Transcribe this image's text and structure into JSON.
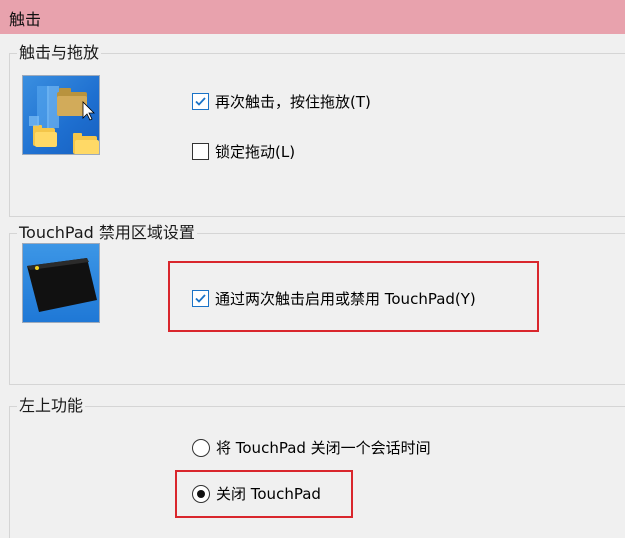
{
  "header": {
    "title": "触击"
  },
  "tap_group": {
    "title": "触击与拖放",
    "options": [
      {
        "label": "再次触击，按住拖放(T)",
        "checked": true
      },
      {
        "label": "锁定拖动(L)",
        "checked": false
      }
    ]
  },
  "disable_group": {
    "title": "TouchPad 禁用区域设置",
    "option": {
      "label": "通过两次触击启用或禁用 TouchPad(Y)",
      "checked": true
    }
  },
  "corner_group": {
    "title": "左上功能",
    "radios": [
      {
        "label": "将 TouchPad 关闭一个会话时间",
        "selected": false
      },
      {
        "label": "关闭 TouchPad",
        "selected": true
      }
    ]
  },
  "colors": {
    "header_bg": "#e8a2ad",
    "highlight": "#d9262c",
    "check_blue": "#1a73c7"
  }
}
